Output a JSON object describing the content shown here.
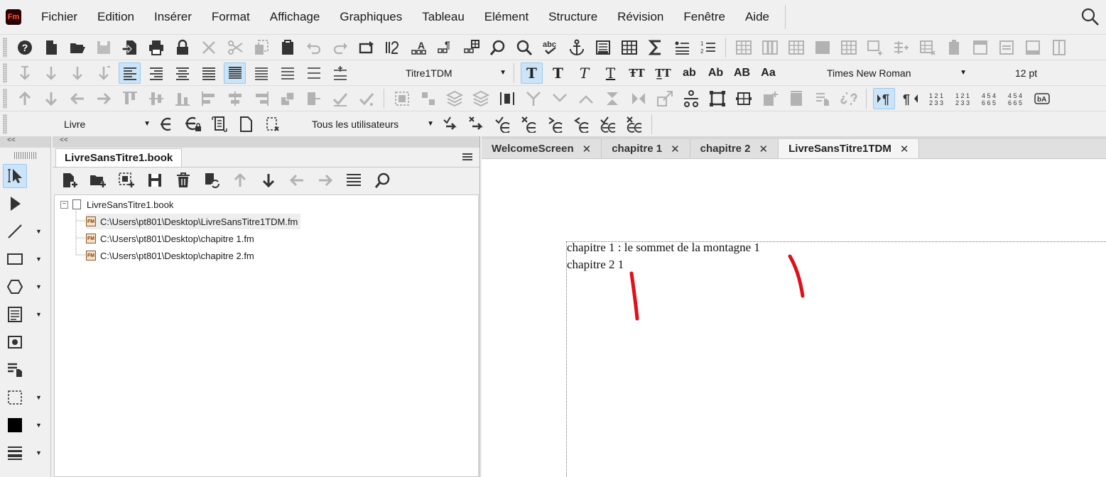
{
  "app": {
    "logo_text": "Fm"
  },
  "menu": [
    "Fichier",
    "Edition",
    "Insérer",
    "Format",
    "Affichage",
    "Graphiques",
    "Tableau",
    "Elément",
    "Structure",
    "Révision",
    "Fenêtre",
    "Aide"
  ],
  "format_bar": {
    "paragraph_tag": "Titre1TDM",
    "font_family": "Times New Roman",
    "font_size": "12 pt",
    "char_glyphs": [
      "T",
      "T",
      "T",
      "T",
      "ŦT",
      "T̲T",
      "ab",
      "Ab",
      "AB",
      "Aa"
    ]
  },
  "track_bar": {
    "book_selector": "Livre",
    "users_selector": "Tous les utilisateurs"
  },
  "palette": {
    "collapse_label": "<<"
  },
  "book_panel": {
    "collapse_label": "<<",
    "tab_label": "LivreSansTitre1.book",
    "tree": {
      "root": "LivreSansTitre1.book",
      "files": [
        "C:\\Users\\pt801\\Desktop\\LivreSansTitre1TDM.fm",
        "C:\\Users\\pt801\\Desktop\\chapitre 1.fm",
        "C:\\Users\\pt801\\Desktop\\chapitre 2.fm"
      ],
      "file_badge": "FM"
    }
  },
  "document": {
    "tabs": [
      {
        "label": "WelcomeScreen",
        "close": "✕"
      },
      {
        "label": "chapitre 1",
        "close": "✕"
      },
      {
        "label": "chapitre 2",
        "close": "✕"
      },
      {
        "label": "LivreSansTitre1TDM",
        "close": "✕"
      }
    ],
    "active_tab": "LivreSansTitre1TDM",
    "toc_lines": [
      "chapitre 1 : le sommet de la montagne 1",
      "chapitre 2 1"
    ],
    "annotation_color": "#e0101a"
  },
  "colors": {
    "toggle_bg": "#cce4f7",
    "toggle_border": "#99c9ef",
    "logo_bg": "#2b0000",
    "logo_fg": "#ff5a36"
  }
}
